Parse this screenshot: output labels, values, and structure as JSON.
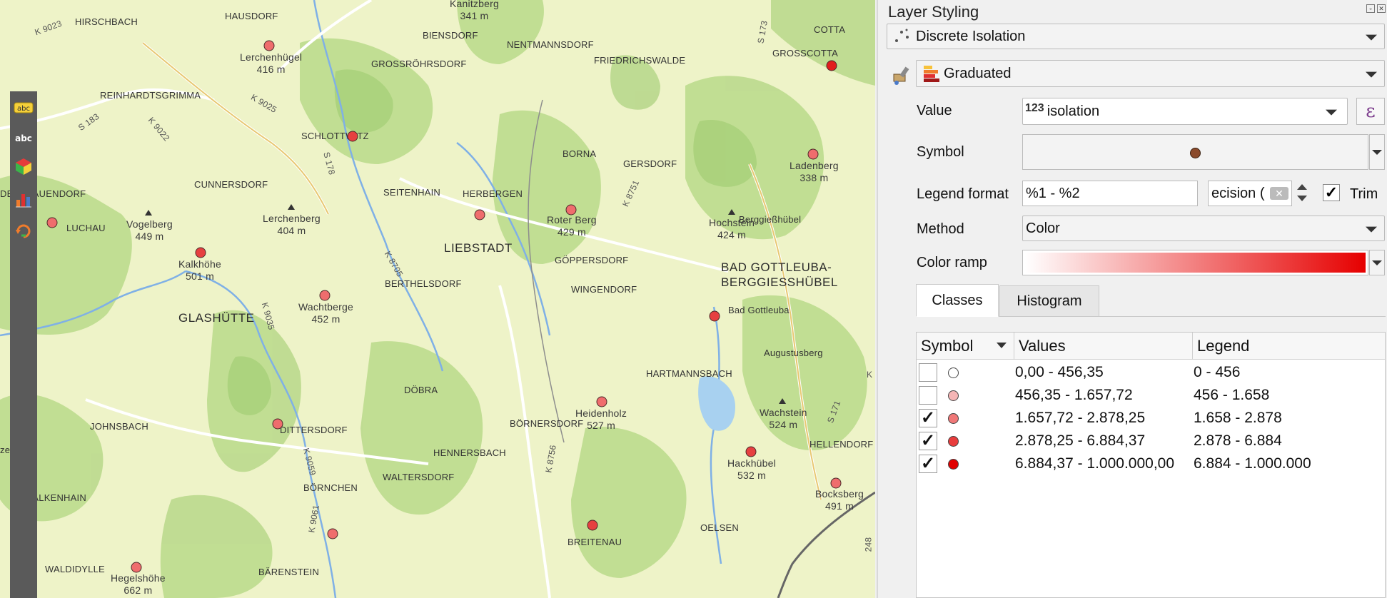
{
  "map": {
    "towns": [
      "LIEBSTADT",
      "GLASHÜTTE",
      "BAD GOTTLEUBA-",
      "BERGGIESSHÜBEL"
    ],
    "places": [
      {
        "name": "HIRSCHBACH"
      },
      {
        "name": "HAUSDORF"
      },
      {
        "name": "BIENSDORF"
      },
      {
        "name": "NENTMANNSDORF"
      },
      {
        "name": "GROSSRÖHRSDORF"
      },
      {
        "name": "FRIEDRICHSWALDE"
      },
      {
        "name": "GROSSCOTTA"
      },
      {
        "name": "COTTA"
      },
      {
        "name": "REINHARDTSGRIMMA"
      },
      {
        "name": "SCHLOTTWITZ"
      },
      {
        "name": "BORNA"
      },
      {
        "name": "GERSDORF"
      },
      {
        "name": "CUNNERSDORF"
      },
      {
        "name": "SEITENHAIN"
      },
      {
        "name": "HERBERGEN"
      },
      {
        "name": "DERFRAUENDORF"
      },
      {
        "name": "LUCHAU"
      },
      {
        "name": "Berggießhübel"
      },
      {
        "name": "GÖPPERSDORF"
      },
      {
        "name": "BERTHELSDORF"
      },
      {
        "name": "WINGENDORF"
      },
      {
        "name": "Bad Gottleuba"
      },
      {
        "name": "Augustusberg"
      },
      {
        "name": "HARTMANNSBACH"
      },
      {
        "name": "DÖBRA"
      },
      {
        "name": "JOHNSBACH"
      },
      {
        "name": "DITTERSDORF"
      },
      {
        "name": "BÖRNERSDORF"
      },
      {
        "name": "HELLENDORF"
      },
      {
        "name": "HENNERSBACH"
      },
      {
        "name": "WALTERSDORF"
      },
      {
        "name": "FALKENHAIN"
      },
      {
        "name": "BÖRNCHEN"
      },
      {
        "name": "OELSEN"
      },
      {
        "name": "BREITENAU"
      },
      {
        "name": "WALDIDYLLE"
      },
      {
        "name": "BÄRENSTEIN"
      },
      {
        "name": "zen"
      }
    ],
    "peaks": [
      {
        "name": "Kanitzberg",
        "elev": "341 m"
      },
      {
        "name": "Lerchenhügel",
        "elev": "416 m"
      },
      {
        "name": "Vogelberg",
        "elev": "449 m"
      },
      {
        "name": "Lerchenberg",
        "elev": "404 m"
      },
      {
        "name": "Kalkhöhe",
        "elev": "501 m"
      },
      {
        "name": "Wachtberge",
        "elev": "452 m"
      },
      {
        "name": "Roter Berg",
        "elev": "429 m"
      },
      {
        "name": "Hochstein",
        "elev": "424 m"
      },
      {
        "name": "Ladenberg",
        "elev": "338 m"
      },
      {
        "name": "Heidenholz",
        "elev": "527 m"
      },
      {
        "name": "Wachstein",
        "elev": "524 m"
      },
      {
        "name": "Hackhübel",
        "elev": "532 m"
      },
      {
        "name": "Bocksberg",
        "elev": "491 m"
      },
      {
        "name": "Hegelshöhe",
        "elev": "662 m"
      }
    ],
    "roads": [
      "K 9023",
      "S 183",
      "K 9022",
      "K 9025",
      "S 178",
      "S 173",
      "K 8705",
      "K 8751",
      "K 9035",
      "S 171",
      "K 9059",
      "K 8756",
      "K 9061",
      "248",
      "K"
    ]
  },
  "panel": {
    "title": "Layer Styling",
    "layer": "Discrete Isolation",
    "renderer": "Graduated",
    "value_label": "Value",
    "value_prefix": "123",
    "value_field": "isolation",
    "expression_icon": "ε",
    "symbol_label": "Symbol",
    "symbol_color": "#8b4a2b",
    "legend_format_label": "Legend format",
    "legend_format": "%1 - %2",
    "precision_text": "ecision (",
    "trim_label": "Trim",
    "trim_checked": "✓",
    "method_label": "Method",
    "method_value": "Color",
    "color_ramp_label": "Color ramp",
    "ramp_from": "#ffffff",
    "ramp_to": "#e60000",
    "tabs": [
      "Classes",
      "Histogram"
    ],
    "table": {
      "headers": [
        "Symbol",
        "Values",
        "Legend"
      ],
      "rows": [
        {
          "checked": "",
          "color": "#ffffff",
          "values": "0,00 - 456,35",
          "legend": "0 - 456"
        },
        {
          "checked": "",
          "color": "#f5b5b5",
          "values": "456,35 - 1.657,72",
          "legend": "456 - 1.658"
        },
        {
          "checked": "✓",
          "color": "#f07878",
          "values": "1.657,72 - 2.878,25",
          "legend": "1.658 - 2.878"
        },
        {
          "checked": "✓",
          "color": "#e83c3c",
          "values": "2.878,25 - 6.884,37",
          "legend": "2.878 - 6.884"
        },
        {
          "checked": "✓",
          "color": "#e00000",
          "values": "6.884,37 - 1.000.000,00",
          "legend": "6.884 - 1.000.000"
        }
      ]
    }
  }
}
